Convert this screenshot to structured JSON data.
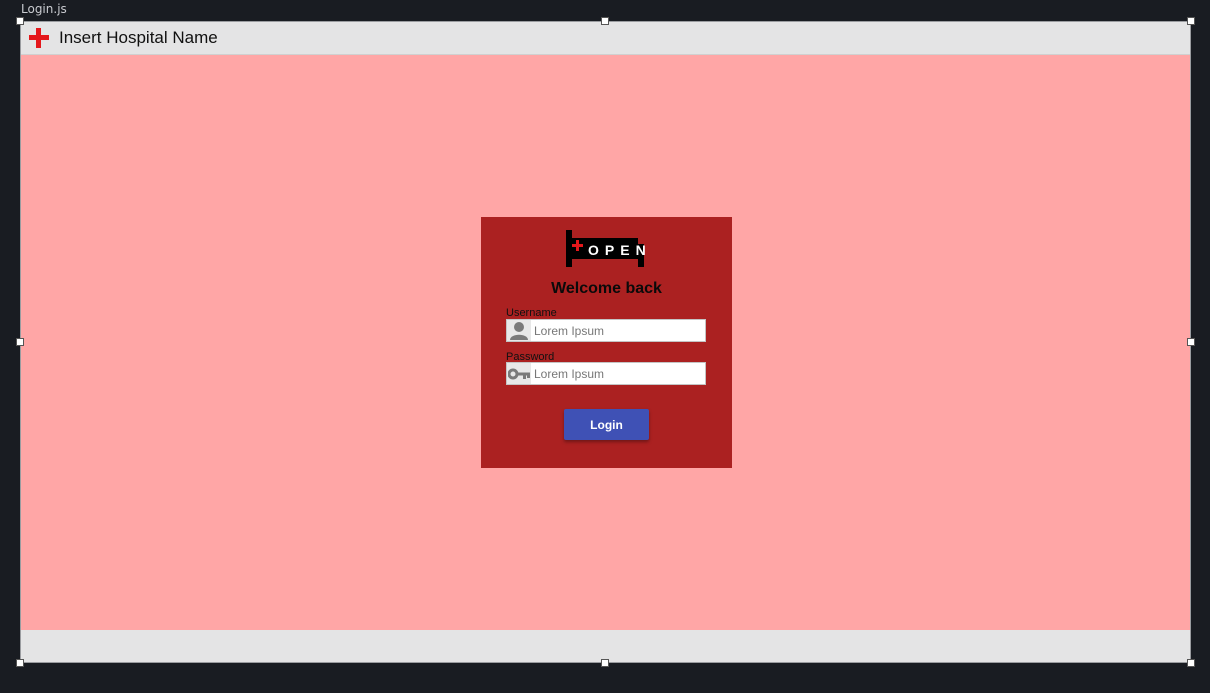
{
  "file_tab": {
    "label": "Login.js"
  },
  "appbar": {
    "title": "Insert Hospital Name",
    "icon": "red-cross-icon"
  },
  "login": {
    "logo_text": "OPEN",
    "heading": "Welcome back",
    "username": {
      "label": "Username",
      "placeholder": "Lorem Ipsum",
      "icon": "user-icon"
    },
    "password": {
      "label": "Password",
      "placeholder": "Lorem Ipsum",
      "icon": "key-icon"
    },
    "button_label": "Login"
  },
  "colors": {
    "canvas": "#ffa6a6",
    "card": "#ab2121",
    "button": "#3f51b5",
    "cross": "#e4171b",
    "editor_bg": "#191c22"
  }
}
